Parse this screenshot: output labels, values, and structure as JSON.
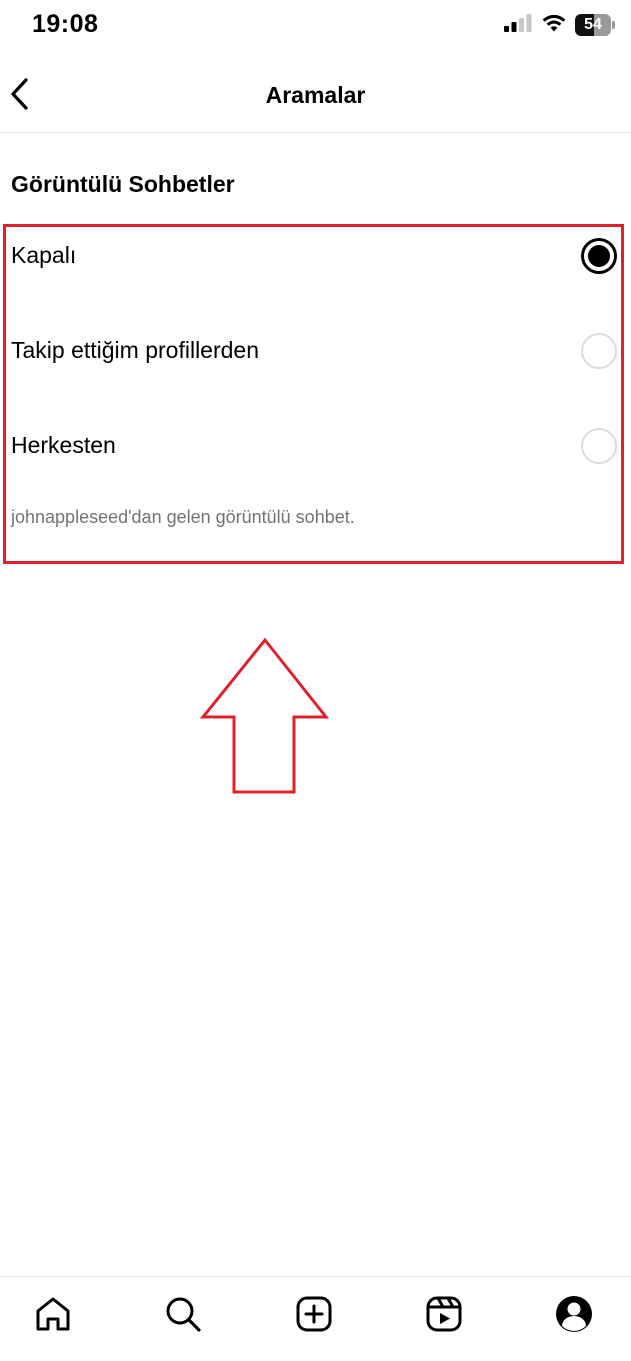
{
  "status_bar": {
    "time": "19:08",
    "battery_level": "54",
    "battery_fraction": 0.54
  },
  "header": {
    "title": "Aramalar",
    "back_icon": "chevron-left-icon"
  },
  "section": {
    "title": "Görüntülü Sohbetler"
  },
  "options": [
    {
      "label": "Kapalı",
      "selected": true
    },
    {
      "label": "Takip ettiğim profillerden",
      "selected": false
    },
    {
      "label": "Herkesten",
      "selected": false
    }
  ],
  "helper_text": "johnappleseed'dan gelen görüntülü sohbet.",
  "annotation": {
    "color": "#e0202a"
  },
  "bottom_nav": {
    "items": [
      "home-icon",
      "search-icon",
      "create-icon",
      "reels-icon",
      "profile-icon"
    ]
  }
}
